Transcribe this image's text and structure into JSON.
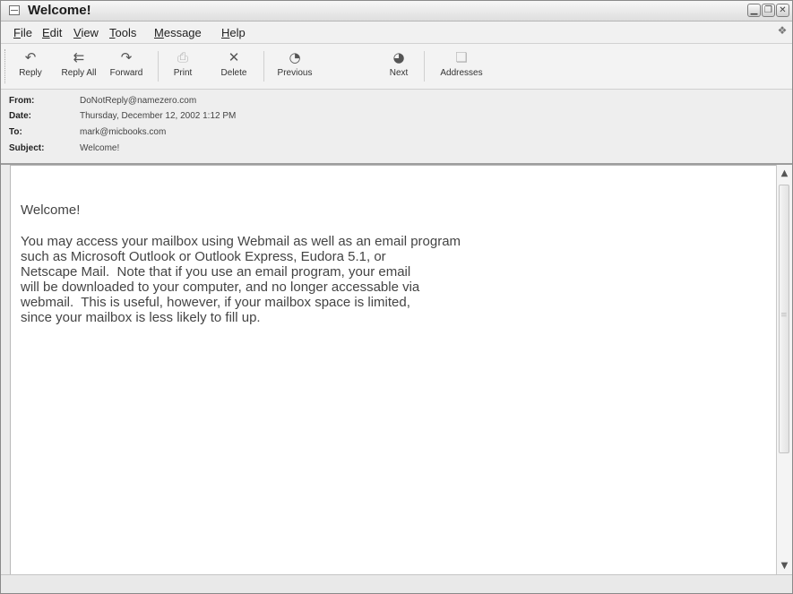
{
  "window": {
    "title": "Welcome!",
    "controls": {
      "minimize": "▁",
      "restore": "❐",
      "close": "✕"
    }
  },
  "menu": [
    {
      "hotkey": "F",
      "rest": "ile"
    },
    {
      "hotkey": "E",
      "rest": "dit"
    },
    {
      "hotkey": "V",
      "rest": "iew"
    },
    {
      "hotkey": "T",
      "rest": "ools"
    },
    {
      "hotkey": "M",
      "rest": "essage"
    },
    {
      "hotkey": "H",
      "rest": "elp"
    }
  ],
  "toolbar": {
    "reply": "Reply",
    "reply_all": "Reply All",
    "forward": "Forward",
    "print": "Print",
    "delete": "Delete",
    "previous": "Previous",
    "next": "Next",
    "addresses": "Addresses"
  },
  "headers": {
    "from_label": "From:",
    "from": "DoNotReply@namezero.com",
    "date_label": "Date:",
    "date": "Thursday, December 12, 2002 1:12 PM",
    "to_label": "To:",
    "to": "mark@micbooks.com",
    "subject_label": "Subject:",
    "subject": "Welcome!"
  },
  "message": {
    "greeting": "Welcome!",
    "lines": [
      "You may access your mailbox using Webmail as well as an email program",
      "such as Microsoft Outlook or Outlook Express, Eudora 5.1, or",
      "Netscape Mail.  Note that if you use an email program, your email",
      "will be downloaded to your computer, and no longer accessable via",
      "webmail.  This is useful, however, if your mailbox space is limited,",
      "since your mailbox is less likely to fill up."
    ]
  }
}
